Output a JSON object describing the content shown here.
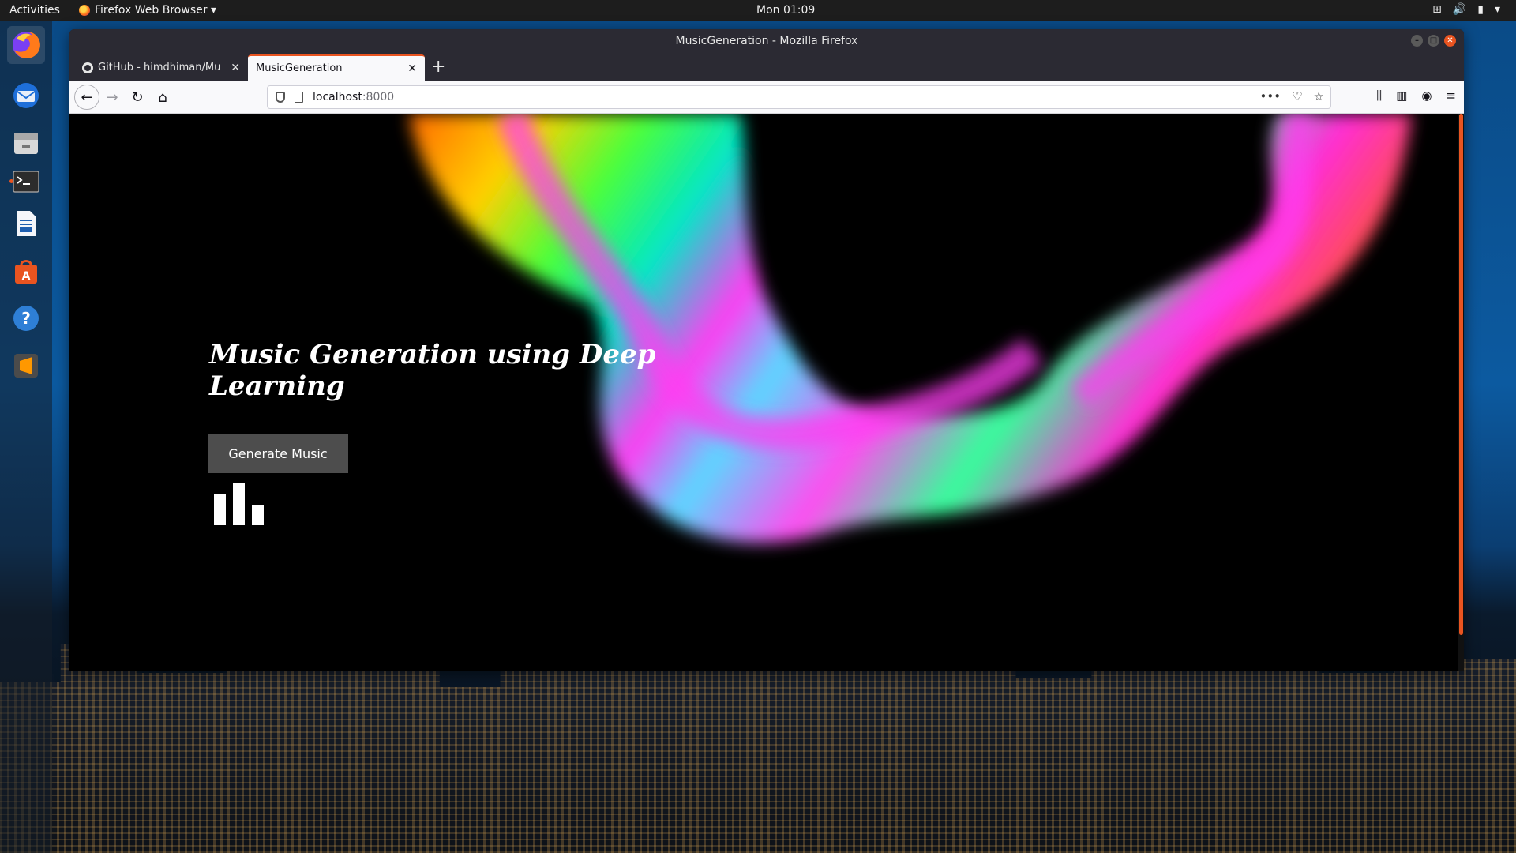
{
  "system": {
    "activities_label": "Activities",
    "app_menu_label": "Firefox Web Browser ▾",
    "clock": "Mon 01:09"
  },
  "dock": {
    "items": [
      {
        "name": "firefox"
      },
      {
        "name": "thunderbird"
      },
      {
        "name": "files"
      },
      {
        "name": "terminal"
      },
      {
        "name": "libreoffice-writer"
      },
      {
        "name": "software"
      },
      {
        "name": "help"
      },
      {
        "name": "sublime-text"
      }
    ]
  },
  "window": {
    "title": "MusicGeneration - Mozilla Firefox",
    "tabs": [
      {
        "label": "GitHub - himdhiman/Mu",
        "close": "✕"
      },
      {
        "label": "MusicGeneration",
        "close": "✕"
      }
    ],
    "new_tab_label": "+",
    "url_host": "localhost",
    "url_port": ":8000",
    "url_actions_more": "•••"
  },
  "page": {
    "title": "Music Generation using Deep Learning",
    "generate_button": "Generate Music",
    "visualizer_levels": [
      0.72,
      1.0,
      0.46
    ]
  },
  "colors": {
    "accent": "#e95420",
    "page_background": "#000000",
    "button_background": "#4d4d4d"
  }
}
